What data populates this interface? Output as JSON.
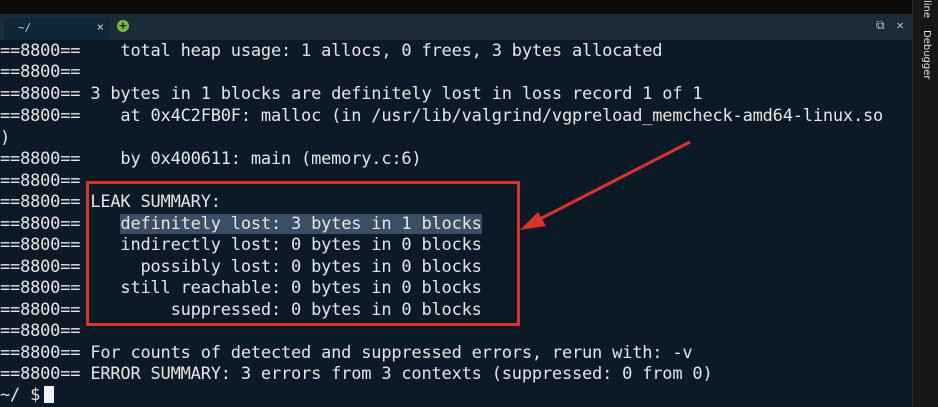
{
  "tab": {
    "title": "~/",
    "close_glyph": "×",
    "new_tab_glyph": "+"
  },
  "window_buttons": {
    "restore": "⧉",
    "close": "✕"
  },
  "sidebar": {
    "items": [
      "line",
      "Debugger"
    ]
  },
  "terminal": {
    "lines": [
      "==8800==    total heap usage: 1 allocs, 0 frees, 3 bytes allocated",
      "==8800==",
      "==8800== 3 bytes in 1 blocks are definitely lost in loss record 1 of 1",
      "==8800==    at 0x4C2FB0F: malloc (in /usr/lib/valgrind/vgpreload_memcheck-amd64-linux.so",
      ")",
      "==8800==    by 0x400611: main (memory.c:6)",
      "==8800==",
      "==8800== LEAK SUMMARY:",
      "==8800==    definitely lost: 3 bytes in 1 blocks",
      "==8800==    indirectly lost: 0 bytes in 0 blocks",
      "==8800==      possibly lost: 0 bytes in 0 blocks",
      "==8800==    still reachable: 0 bytes in 0 blocks",
      "==8800==         suppressed: 0 bytes in 0 blocks",
      "==8800==",
      "==8800== For counts of detected and suppressed errors, rerun with: -v",
      "==8800== ERROR SUMMARY: 3 errors from 3 contexts (suppressed: 0 from 0)"
    ],
    "highlight": {
      "prefix": "==8800==    ",
      "text": "definitely lost: 3 bytes in 1 blocks"
    },
    "prompt": "~/ $"
  },
  "colors": {
    "background": "#0b1a26",
    "text": "#e6e6e6",
    "annotation": "#d9342b",
    "selection": "#3a4e66"
  }
}
